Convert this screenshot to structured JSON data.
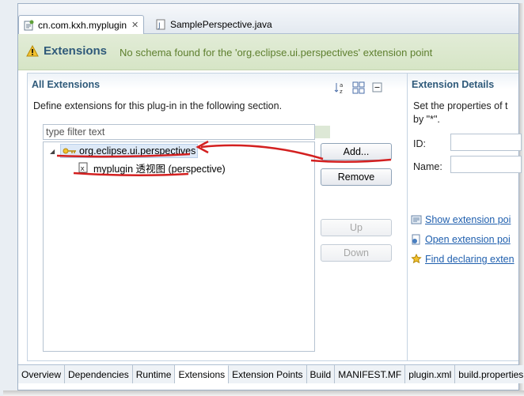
{
  "editor_tabs": [
    {
      "label": "cn.com.kxh.myplugin",
      "active": true,
      "icon": "plugin-icon",
      "closable": true
    },
    {
      "label": "SamplePerspective.java",
      "active": false,
      "icon": "java-file-icon"
    }
  ],
  "header": {
    "title": "Extensions",
    "message": "No schema found for the 'org.eclipse.ui.perspectives' extension point",
    "icon": "warning-icon"
  },
  "all_extensions": {
    "title": "All Extensions",
    "description": "Define extensions for this plug-in in the following section.",
    "filter_placeholder": "type filter text",
    "toolbar_icons": [
      "sort-alphabetical-icon",
      "show-details-icon",
      "collapse-all-icon"
    ],
    "tree": [
      {
        "label": "org.eclipse.ui.perspectives",
        "expanded": true,
        "selected": true,
        "children": [
          {
            "label": "myplugin 透视图 (perspective)"
          }
        ]
      }
    ],
    "buttons": {
      "add": "Add...",
      "remove": "Remove",
      "up": "Up",
      "down": "Down"
    }
  },
  "extension_details": {
    "title": "Extension Details",
    "description_line1": "Set the properties of t",
    "description_line2": "by \"*\".",
    "id_label": "ID:",
    "name_label": "Name:",
    "links": [
      "Show extension poi",
      "Open extension poi",
      "Find declaring exten"
    ]
  },
  "bottom_tabs": [
    "Overview",
    "Dependencies",
    "Runtime",
    "Extensions",
    "Extension Points",
    "Build",
    "MANIFEST.MF",
    "plugin.xml",
    "build.properties"
  ],
  "active_bottom_tab": "Extensions",
  "colors": {
    "section_title": "#2f5a7a",
    "header_message": "#5e7f2e",
    "link": "#1f5fae",
    "annotation": "#d32020"
  }
}
